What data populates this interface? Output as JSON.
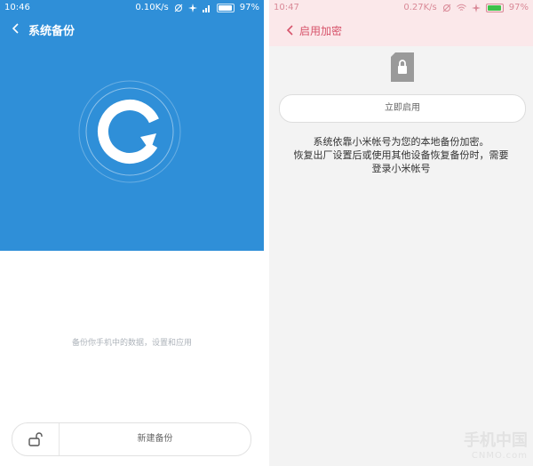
{
  "left": {
    "status": {
      "time": "10:46",
      "speed": "0.10K/s",
      "battery": "97%",
      "battery_level": 0.97
    },
    "header": {
      "title": "系统备份"
    },
    "hint": "备份你手机中的数据，设置和应用",
    "bottom": {
      "new_backup_label": "新建备份"
    },
    "colors": {
      "header_bg": "#2f8fd8"
    },
    "icons": [
      "back-chevron-icon",
      "backup-refresh-icon",
      "unlock-icon",
      "signal-icon",
      "wifi-icon",
      "airplane-icon",
      "no-alarm-icon",
      "battery-icon"
    ]
  },
  "right": {
    "status": {
      "time": "10:47",
      "speed": "0.27K/s",
      "battery": "97%",
      "battery_level": 0.97
    },
    "header": {
      "title": "启用加密"
    },
    "enable_label": "立即启用",
    "description": {
      "line1": "系统依靠小米帐号为您的本地备份加密。",
      "line2": "恢复出厂设置后或使用其他设备恢复备份时，需要",
      "line3": "登录小米帐号"
    },
    "colors": {
      "header_bg": "#fbe8ea",
      "accent": "#d7546b"
    },
    "icons": [
      "back-chevron-icon",
      "lock-file-icon",
      "wifi-icon",
      "airplane-icon",
      "no-alarm-icon",
      "battery-icon"
    ]
  },
  "watermark": {
    "text": "手机中国",
    "sub": "CNMO.com"
  }
}
